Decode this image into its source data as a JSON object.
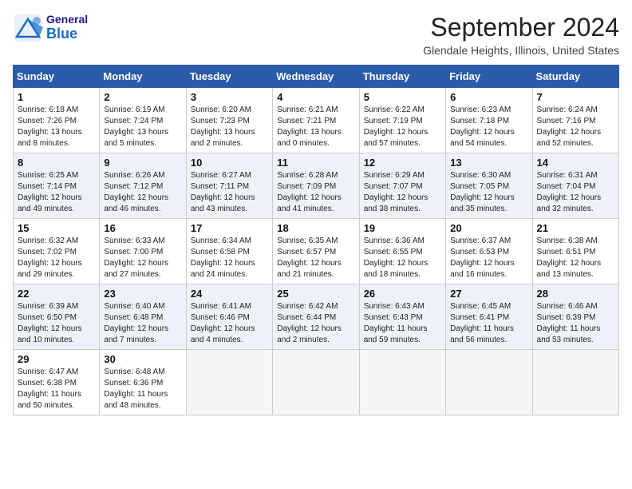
{
  "header": {
    "logo_general": "General",
    "logo_blue": "Blue",
    "month_title": "September 2024",
    "location": "Glendale Heights, Illinois, United States"
  },
  "columns": [
    "Sunday",
    "Monday",
    "Tuesday",
    "Wednesday",
    "Thursday",
    "Friday",
    "Saturday"
  ],
  "weeks": [
    [
      {
        "day": "1",
        "sunrise": "6:18 AM",
        "sunset": "7:26 PM",
        "daylight": "13 hours and 8 minutes."
      },
      {
        "day": "2",
        "sunrise": "6:19 AM",
        "sunset": "7:24 PM",
        "daylight": "13 hours and 5 minutes."
      },
      {
        "day": "3",
        "sunrise": "6:20 AM",
        "sunset": "7:23 PM",
        "daylight": "13 hours and 2 minutes."
      },
      {
        "day": "4",
        "sunrise": "6:21 AM",
        "sunset": "7:21 PM",
        "daylight": "13 hours and 0 minutes."
      },
      {
        "day": "5",
        "sunrise": "6:22 AM",
        "sunset": "7:19 PM",
        "daylight": "12 hours and 57 minutes."
      },
      {
        "day": "6",
        "sunrise": "6:23 AM",
        "sunset": "7:18 PM",
        "daylight": "12 hours and 54 minutes."
      },
      {
        "day": "7",
        "sunrise": "6:24 AM",
        "sunset": "7:16 PM",
        "daylight": "12 hours and 52 minutes."
      }
    ],
    [
      {
        "day": "8",
        "sunrise": "6:25 AM",
        "sunset": "7:14 PM",
        "daylight": "12 hours and 49 minutes."
      },
      {
        "day": "9",
        "sunrise": "6:26 AM",
        "sunset": "7:12 PM",
        "daylight": "12 hours and 46 minutes."
      },
      {
        "day": "10",
        "sunrise": "6:27 AM",
        "sunset": "7:11 PM",
        "daylight": "12 hours and 43 minutes."
      },
      {
        "day": "11",
        "sunrise": "6:28 AM",
        "sunset": "7:09 PM",
        "daylight": "12 hours and 41 minutes."
      },
      {
        "day": "12",
        "sunrise": "6:29 AM",
        "sunset": "7:07 PM",
        "daylight": "12 hours and 38 minutes."
      },
      {
        "day": "13",
        "sunrise": "6:30 AM",
        "sunset": "7:05 PM",
        "daylight": "12 hours and 35 minutes."
      },
      {
        "day": "14",
        "sunrise": "6:31 AM",
        "sunset": "7:04 PM",
        "daylight": "12 hours and 32 minutes."
      }
    ],
    [
      {
        "day": "15",
        "sunrise": "6:32 AM",
        "sunset": "7:02 PM",
        "daylight": "12 hours and 29 minutes."
      },
      {
        "day": "16",
        "sunrise": "6:33 AM",
        "sunset": "7:00 PM",
        "daylight": "12 hours and 27 minutes."
      },
      {
        "day": "17",
        "sunrise": "6:34 AM",
        "sunset": "6:58 PM",
        "daylight": "12 hours and 24 minutes."
      },
      {
        "day": "18",
        "sunrise": "6:35 AM",
        "sunset": "6:57 PM",
        "daylight": "12 hours and 21 minutes."
      },
      {
        "day": "19",
        "sunrise": "6:36 AM",
        "sunset": "6:55 PM",
        "daylight": "12 hours and 18 minutes."
      },
      {
        "day": "20",
        "sunrise": "6:37 AM",
        "sunset": "6:53 PM",
        "daylight": "12 hours and 16 minutes."
      },
      {
        "day": "21",
        "sunrise": "6:38 AM",
        "sunset": "6:51 PM",
        "daylight": "12 hours and 13 minutes."
      }
    ],
    [
      {
        "day": "22",
        "sunrise": "6:39 AM",
        "sunset": "6:50 PM",
        "daylight": "12 hours and 10 minutes."
      },
      {
        "day": "23",
        "sunrise": "6:40 AM",
        "sunset": "6:48 PM",
        "daylight": "12 hours and 7 minutes."
      },
      {
        "day": "24",
        "sunrise": "6:41 AM",
        "sunset": "6:46 PM",
        "daylight": "12 hours and 4 minutes."
      },
      {
        "day": "25",
        "sunrise": "6:42 AM",
        "sunset": "6:44 PM",
        "daylight": "12 hours and 2 minutes."
      },
      {
        "day": "26",
        "sunrise": "6:43 AM",
        "sunset": "6:43 PM",
        "daylight": "11 hours and 59 minutes."
      },
      {
        "day": "27",
        "sunrise": "6:45 AM",
        "sunset": "6:41 PM",
        "daylight": "11 hours and 56 minutes."
      },
      {
        "day": "28",
        "sunrise": "6:46 AM",
        "sunset": "6:39 PM",
        "daylight": "11 hours and 53 minutes."
      }
    ],
    [
      {
        "day": "29",
        "sunrise": "6:47 AM",
        "sunset": "6:38 PM",
        "daylight": "11 hours and 50 minutes."
      },
      {
        "day": "30",
        "sunrise": "6:48 AM",
        "sunset": "6:36 PM",
        "daylight": "11 hours and 48 minutes."
      },
      null,
      null,
      null,
      null,
      null
    ]
  ]
}
